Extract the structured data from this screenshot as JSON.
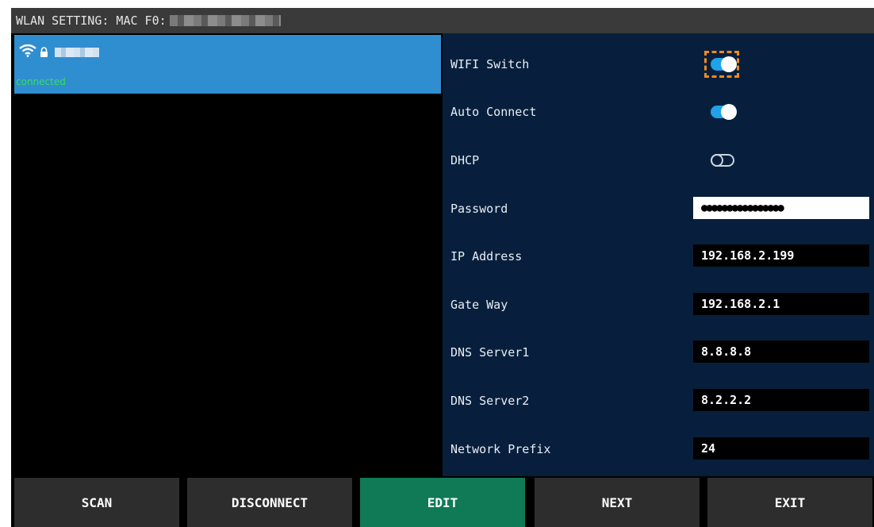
{
  "window": {
    "title_prefix": "WLAN SETTING: MAC F0:"
  },
  "network_list": {
    "items": [
      {
        "status": "connected",
        "selected": true,
        "secured": true
      }
    ]
  },
  "settings": {
    "wifi_switch": {
      "label": "WIFI Switch",
      "on": true,
      "focused": true
    },
    "auto_connect": {
      "label": "Auto Connect",
      "on": true
    },
    "dhcp": {
      "label": "DHCP",
      "on": false
    },
    "password": {
      "label": "Password",
      "value": "●●●●●●●●●●●●●●●●"
    },
    "ip_address": {
      "label": "IP Address",
      "value": "192.168.2.199"
    },
    "gateway": {
      "label": "Gate Way",
      "value": "192.168.2.1"
    },
    "dns1": {
      "label": "DNS Server1",
      "value": "8.8.8.8"
    },
    "dns2": {
      "label": "DNS Server2",
      "value": "8.2.2.2"
    },
    "prefix": {
      "label": "Network Prefix",
      "value": "24"
    }
  },
  "buttons": {
    "scan": "SCAN",
    "disconnect": "DISCONNECT",
    "edit": "EDIT",
    "next": "NEXT",
    "exit": "EXIT"
  },
  "colors": {
    "selected_item": "#2f8ed0",
    "connected_text": "#33e05a",
    "settings_bg": "#071f3c",
    "toggle_on": "#1fa2e8",
    "focus": "#f08a1c",
    "active_button": "#0f7a55"
  },
  "icons": {
    "wifi": "wifi-icon",
    "lock": "lock-icon"
  }
}
